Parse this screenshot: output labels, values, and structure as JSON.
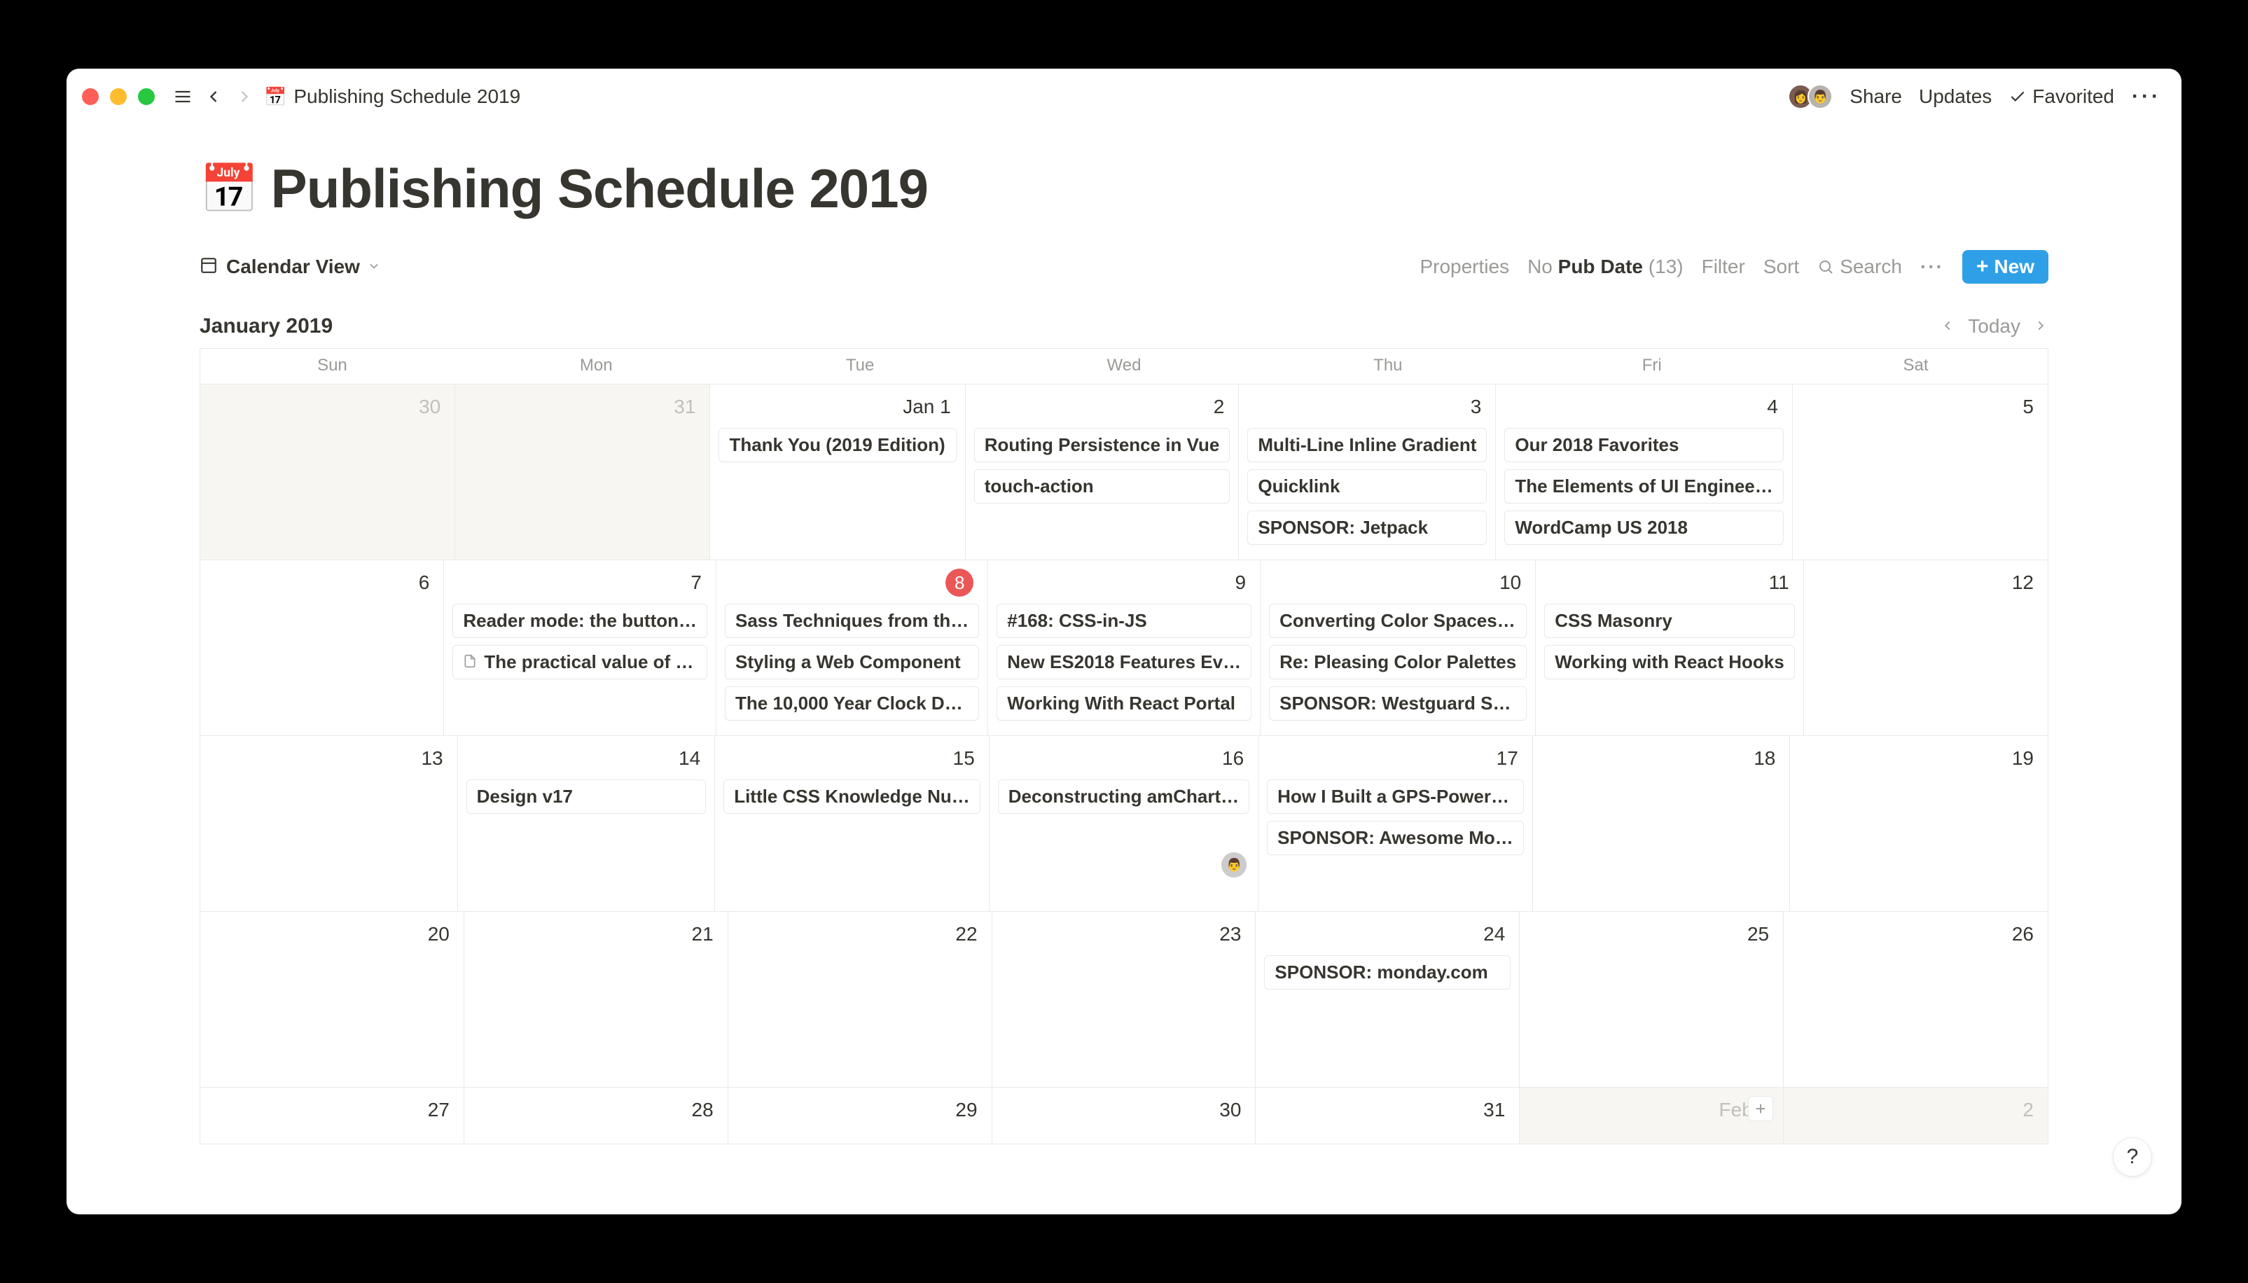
{
  "titlebar": {
    "breadcrumb_icon": "📅",
    "breadcrumb": "Publishing Schedule 2019",
    "share": "Share",
    "updates": "Updates",
    "favorited": "Favorited"
  },
  "page": {
    "icon": "📅",
    "title": "Publishing Schedule 2019"
  },
  "viewbar": {
    "view_label": "Calendar View",
    "properties": "Properties",
    "no_pubdate_prefix": "No ",
    "no_pubdate_bold": "Pub Date",
    "no_pubdate_count": "(13)",
    "filter": "Filter",
    "sort": "Sort",
    "search": "Search",
    "new": "New"
  },
  "calendar": {
    "month_label": "January 2019",
    "today": "Today",
    "dow": [
      "Sun",
      "Mon",
      "Tue",
      "Wed",
      "Thu",
      "Fri",
      "Sat"
    ],
    "weeks": [
      [
        {
          "n": "30",
          "off": true
        },
        {
          "n": "31",
          "off": true
        },
        {
          "n": "Jan 1",
          "first": true,
          "events": [
            {
              "t": "Thank You (2019 Edition)"
            }
          ]
        },
        {
          "n": "2",
          "events": [
            {
              "t": "Routing Persistence in Vue"
            },
            {
              "t": "touch-action"
            }
          ]
        },
        {
          "n": "3",
          "events": [
            {
              "t": "Multi-Line Inline Gradient"
            },
            {
              "t": "Quicklink"
            },
            {
              "t": "SPONSOR: Jetpack"
            }
          ]
        },
        {
          "n": "4",
          "events": [
            {
              "t": "Our 2018 Favorites"
            },
            {
              "t": "The Elements of UI Enginee…"
            },
            {
              "t": "WordCamp US 2018"
            }
          ]
        },
        {
          "n": "5"
        }
      ],
      [
        {
          "n": "6"
        },
        {
          "n": "7",
          "events": [
            {
              "t": "Reader mode: the button…"
            },
            {
              "t": "The practical value of …",
              "doc": true
            }
          ]
        },
        {
          "n": "8",
          "today": true,
          "events": [
            {
              "t": "Sass Techniques from th…"
            },
            {
              "t": "Styling a Web Component"
            },
            {
              "t": "The 10,000 Year Clock D…"
            }
          ]
        },
        {
          "n": "9",
          "events": [
            {
              "t": "#168: CSS-in-JS"
            },
            {
              "t": "New ES2018 Features Ev…"
            },
            {
              "t": "Working With React Portal"
            }
          ]
        },
        {
          "n": "10",
          "events": [
            {
              "t": "Converting Color Spaces…"
            },
            {
              "t": "Re: Pleasing Color Palettes"
            },
            {
              "t": "SPONSOR: Westguard S…"
            }
          ]
        },
        {
          "n": "11",
          "events": [
            {
              "t": "CSS Masonry"
            },
            {
              "t": "Working with React Hooks"
            }
          ]
        },
        {
          "n": "12"
        }
      ],
      [
        {
          "n": "13"
        },
        {
          "n": "14",
          "events": [
            {
              "t": "Design v17"
            }
          ]
        },
        {
          "n": "15",
          "events": [
            {
              "t": "Little CSS Knowledge Nu…"
            }
          ]
        },
        {
          "n": "16",
          "events": [
            {
              "t": "Deconstructing amChart…"
            }
          ],
          "avatar": true
        },
        {
          "n": "17",
          "events": [
            {
              "t": "How I Built a GPS-Power…"
            },
            {
              "t": "SPONSOR: Awesome Mo…"
            }
          ]
        },
        {
          "n": "18"
        },
        {
          "n": "19"
        }
      ],
      [
        {
          "n": "20"
        },
        {
          "n": "21"
        },
        {
          "n": "22"
        },
        {
          "n": "23"
        },
        {
          "n": "24",
          "events": [
            {
              "t": "SPONSOR: monday.com"
            }
          ]
        },
        {
          "n": "25"
        },
        {
          "n": "26"
        }
      ],
      [
        {
          "n": "27"
        },
        {
          "n": "28"
        },
        {
          "n": "29"
        },
        {
          "n": "30"
        },
        {
          "n": "31"
        },
        {
          "n": "Feb 1",
          "off": true,
          "first": true,
          "add": true
        },
        {
          "n": "2",
          "off": true
        }
      ]
    ]
  },
  "help": "?"
}
